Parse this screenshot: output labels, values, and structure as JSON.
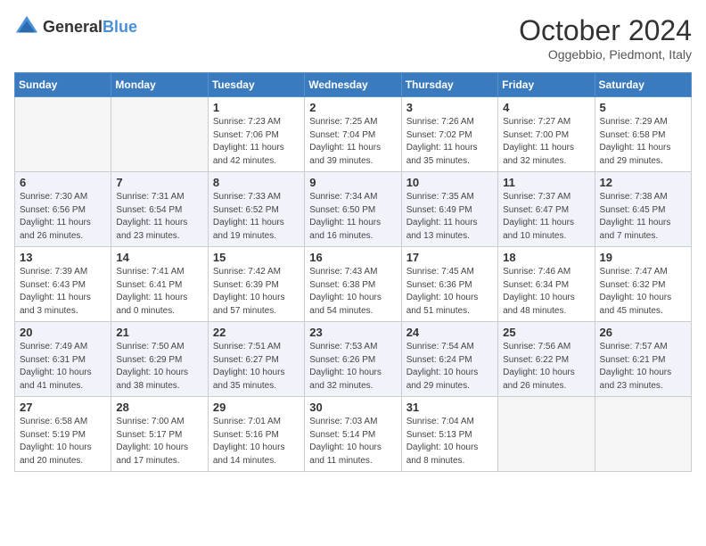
{
  "header": {
    "logo_general": "General",
    "logo_blue": "Blue",
    "month": "October 2024",
    "location": "Oggebbio, Piedmont, Italy"
  },
  "days_of_week": [
    "Sunday",
    "Monday",
    "Tuesday",
    "Wednesday",
    "Thursday",
    "Friday",
    "Saturday"
  ],
  "weeks": [
    [
      {
        "day": "",
        "empty": true
      },
      {
        "day": "",
        "empty": true
      },
      {
        "day": "1",
        "sunrise": "Sunrise: 7:23 AM",
        "sunset": "Sunset: 7:06 PM",
        "daylight": "Daylight: 11 hours and 42 minutes."
      },
      {
        "day": "2",
        "sunrise": "Sunrise: 7:25 AM",
        "sunset": "Sunset: 7:04 PM",
        "daylight": "Daylight: 11 hours and 39 minutes."
      },
      {
        "day": "3",
        "sunrise": "Sunrise: 7:26 AM",
        "sunset": "Sunset: 7:02 PM",
        "daylight": "Daylight: 11 hours and 35 minutes."
      },
      {
        "day": "4",
        "sunrise": "Sunrise: 7:27 AM",
        "sunset": "Sunset: 7:00 PM",
        "daylight": "Daylight: 11 hours and 32 minutes."
      },
      {
        "day": "5",
        "sunrise": "Sunrise: 7:29 AM",
        "sunset": "Sunset: 6:58 PM",
        "daylight": "Daylight: 11 hours and 29 minutes."
      }
    ],
    [
      {
        "day": "6",
        "sunrise": "Sunrise: 7:30 AM",
        "sunset": "Sunset: 6:56 PM",
        "daylight": "Daylight: 11 hours and 26 minutes."
      },
      {
        "day": "7",
        "sunrise": "Sunrise: 7:31 AM",
        "sunset": "Sunset: 6:54 PM",
        "daylight": "Daylight: 11 hours and 23 minutes."
      },
      {
        "day": "8",
        "sunrise": "Sunrise: 7:33 AM",
        "sunset": "Sunset: 6:52 PM",
        "daylight": "Daylight: 11 hours and 19 minutes."
      },
      {
        "day": "9",
        "sunrise": "Sunrise: 7:34 AM",
        "sunset": "Sunset: 6:50 PM",
        "daylight": "Daylight: 11 hours and 16 minutes."
      },
      {
        "day": "10",
        "sunrise": "Sunrise: 7:35 AM",
        "sunset": "Sunset: 6:49 PM",
        "daylight": "Daylight: 11 hours and 13 minutes."
      },
      {
        "day": "11",
        "sunrise": "Sunrise: 7:37 AM",
        "sunset": "Sunset: 6:47 PM",
        "daylight": "Daylight: 11 hours and 10 minutes."
      },
      {
        "day": "12",
        "sunrise": "Sunrise: 7:38 AM",
        "sunset": "Sunset: 6:45 PM",
        "daylight": "Daylight: 11 hours and 7 minutes."
      }
    ],
    [
      {
        "day": "13",
        "sunrise": "Sunrise: 7:39 AM",
        "sunset": "Sunset: 6:43 PM",
        "daylight": "Daylight: 11 hours and 3 minutes."
      },
      {
        "day": "14",
        "sunrise": "Sunrise: 7:41 AM",
        "sunset": "Sunset: 6:41 PM",
        "daylight": "Daylight: 11 hours and 0 minutes."
      },
      {
        "day": "15",
        "sunrise": "Sunrise: 7:42 AM",
        "sunset": "Sunset: 6:39 PM",
        "daylight": "Daylight: 10 hours and 57 minutes."
      },
      {
        "day": "16",
        "sunrise": "Sunrise: 7:43 AM",
        "sunset": "Sunset: 6:38 PM",
        "daylight": "Daylight: 10 hours and 54 minutes."
      },
      {
        "day": "17",
        "sunrise": "Sunrise: 7:45 AM",
        "sunset": "Sunset: 6:36 PM",
        "daylight": "Daylight: 10 hours and 51 minutes."
      },
      {
        "day": "18",
        "sunrise": "Sunrise: 7:46 AM",
        "sunset": "Sunset: 6:34 PM",
        "daylight": "Daylight: 10 hours and 48 minutes."
      },
      {
        "day": "19",
        "sunrise": "Sunrise: 7:47 AM",
        "sunset": "Sunset: 6:32 PM",
        "daylight": "Daylight: 10 hours and 45 minutes."
      }
    ],
    [
      {
        "day": "20",
        "sunrise": "Sunrise: 7:49 AM",
        "sunset": "Sunset: 6:31 PM",
        "daylight": "Daylight: 10 hours and 41 minutes."
      },
      {
        "day": "21",
        "sunrise": "Sunrise: 7:50 AM",
        "sunset": "Sunset: 6:29 PM",
        "daylight": "Daylight: 10 hours and 38 minutes."
      },
      {
        "day": "22",
        "sunrise": "Sunrise: 7:51 AM",
        "sunset": "Sunset: 6:27 PM",
        "daylight": "Daylight: 10 hours and 35 minutes."
      },
      {
        "day": "23",
        "sunrise": "Sunrise: 7:53 AM",
        "sunset": "Sunset: 6:26 PM",
        "daylight": "Daylight: 10 hours and 32 minutes."
      },
      {
        "day": "24",
        "sunrise": "Sunrise: 7:54 AM",
        "sunset": "Sunset: 6:24 PM",
        "daylight": "Daylight: 10 hours and 29 minutes."
      },
      {
        "day": "25",
        "sunrise": "Sunrise: 7:56 AM",
        "sunset": "Sunset: 6:22 PM",
        "daylight": "Daylight: 10 hours and 26 minutes."
      },
      {
        "day": "26",
        "sunrise": "Sunrise: 7:57 AM",
        "sunset": "Sunset: 6:21 PM",
        "daylight": "Daylight: 10 hours and 23 minutes."
      }
    ],
    [
      {
        "day": "27",
        "sunrise": "Sunrise: 6:58 AM",
        "sunset": "Sunset: 5:19 PM",
        "daylight": "Daylight: 10 hours and 20 minutes."
      },
      {
        "day": "28",
        "sunrise": "Sunrise: 7:00 AM",
        "sunset": "Sunset: 5:17 PM",
        "daylight": "Daylight: 10 hours and 17 minutes."
      },
      {
        "day": "29",
        "sunrise": "Sunrise: 7:01 AM",
        "sunset": "Sunset: 5:16 PM",
        "daylight": "Daylight: 10 hours and 14 minutes."
      },
      {
        "day": "30",
        "sunrise": "Sunrise: 7:03 AM",
        "sunset": "Sunset: 5:14 PM",
        "daylight": "Daylight: 10 hours and 11 minutes."
      },
      {
        "day": "31",
        "sunrise": "Sunrise: 7:04 AM",
        "sunset": "Sunset: 5:13 PM",
        "daylight": "Daylight: 10 hours and 8 minutes."
      },
      {
        "day": "",
        "empty": true
      },
      {
        "day": "",
        "empty": true
      }
    ]
  ]
}
